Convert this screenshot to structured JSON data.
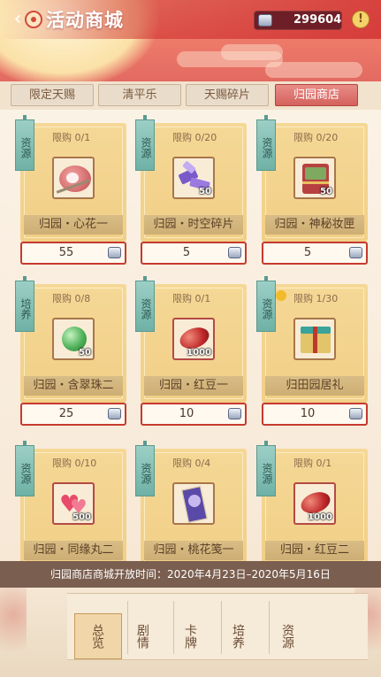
{
  "header": {
    "title": "活动商城",
    "back_icon": "back-arrow-icon",
    "currency_value": "299604",
    "currency_icon": "jade-coin-icon",
    "alert_glyph": "!"
  },
  "tabs": [
    {
      "label": "限定天赐",
      "active": false
    },
    {
      "label": "清平乐",
      "active": false
    },
    {
      "label": "天赐碎片",
      "active": false
    },
    {
      "label": "归园商店",
      "active": true
    }
  ],
  "items": [
    {
      "ribbon": "资源",
      "limit": "限购 0/1",
      "name": "归园・心花一",
      "price": "55",
      "count": "",
      "art": "flower-hairpin"
    },
    {
      "ribbon": "资源",
      "limit": "限购 0/20",
      "name": "归园・时空碎片",
      "price": "5",
      "count": "50",
      "art": "purple-crystals"
    },
    {
      "ribbon": "资源",
      "limit": "限购 0/20",
      "name": "归园・神秘妆匣",
      "price": "5",
      "count": "50",
      "art": "gift-chest"
    },
    {
      "ribbon": "培养",
      "limit": "限购 0/8",
      "name": "归园・含翠珠二",
      "price": "25",
      "count": "50",
      "art": "green-pearl"
    },
    {
      "ribbon": "资源",
      "limit": "限购 0/1",
      "name": "归园・红豆一",
      "price": "10",
      "count": "1000",
      "art": "red-bean"
    },
    {
      "ribbon": "资源",
      "limit": "限购 1/30",
      "name": "归田园居礼",
      "price": "10",
      "count": "",
      "art": "gift-box"
    },
    {
      "ribbon": "资源",
      "limit": "限购 0/10",
      "name": "归园・同缘丸二",
      "price": "",
      "count": "500",
      "art": "hearts"
    },
    {
      "ribbon": "资源",
      "limit": "限购 0/4",
      "name": "归园・桃花笺一",
      "price": "",
      "count": "",
      "art": "purple-letter"
    },
    {
      "ribbon": "资源",
      "limit": "限购 0/1",
      "name": "归园・红豆二",
      "price": "",
      "count": "1000",
      "art": "red-bean"
    }
  ],
  "notice": "归园商店商城开放时间：2020年4月23日–2020年5月16日",
  "bottom_nav": [
    {
      "label": "总览",
      "active": true
    },
    {
      "label": "剧情",
      "active": false
    },
    {
      "label": "卡牌",
      "active": false
    },
    {
      "label": "培养",
      "active": false
    },
    {
      "label": "资源",
      "active": false
    }
  ],
  "colors": {
    "header_red": "#e36a62",
    "tab_active": "#d4625c",
    "card_gold": "#f1cf86",
    "ribbon_teal": "#6fb1a6",
    "price_border": "#c63a2e"
  }
}
